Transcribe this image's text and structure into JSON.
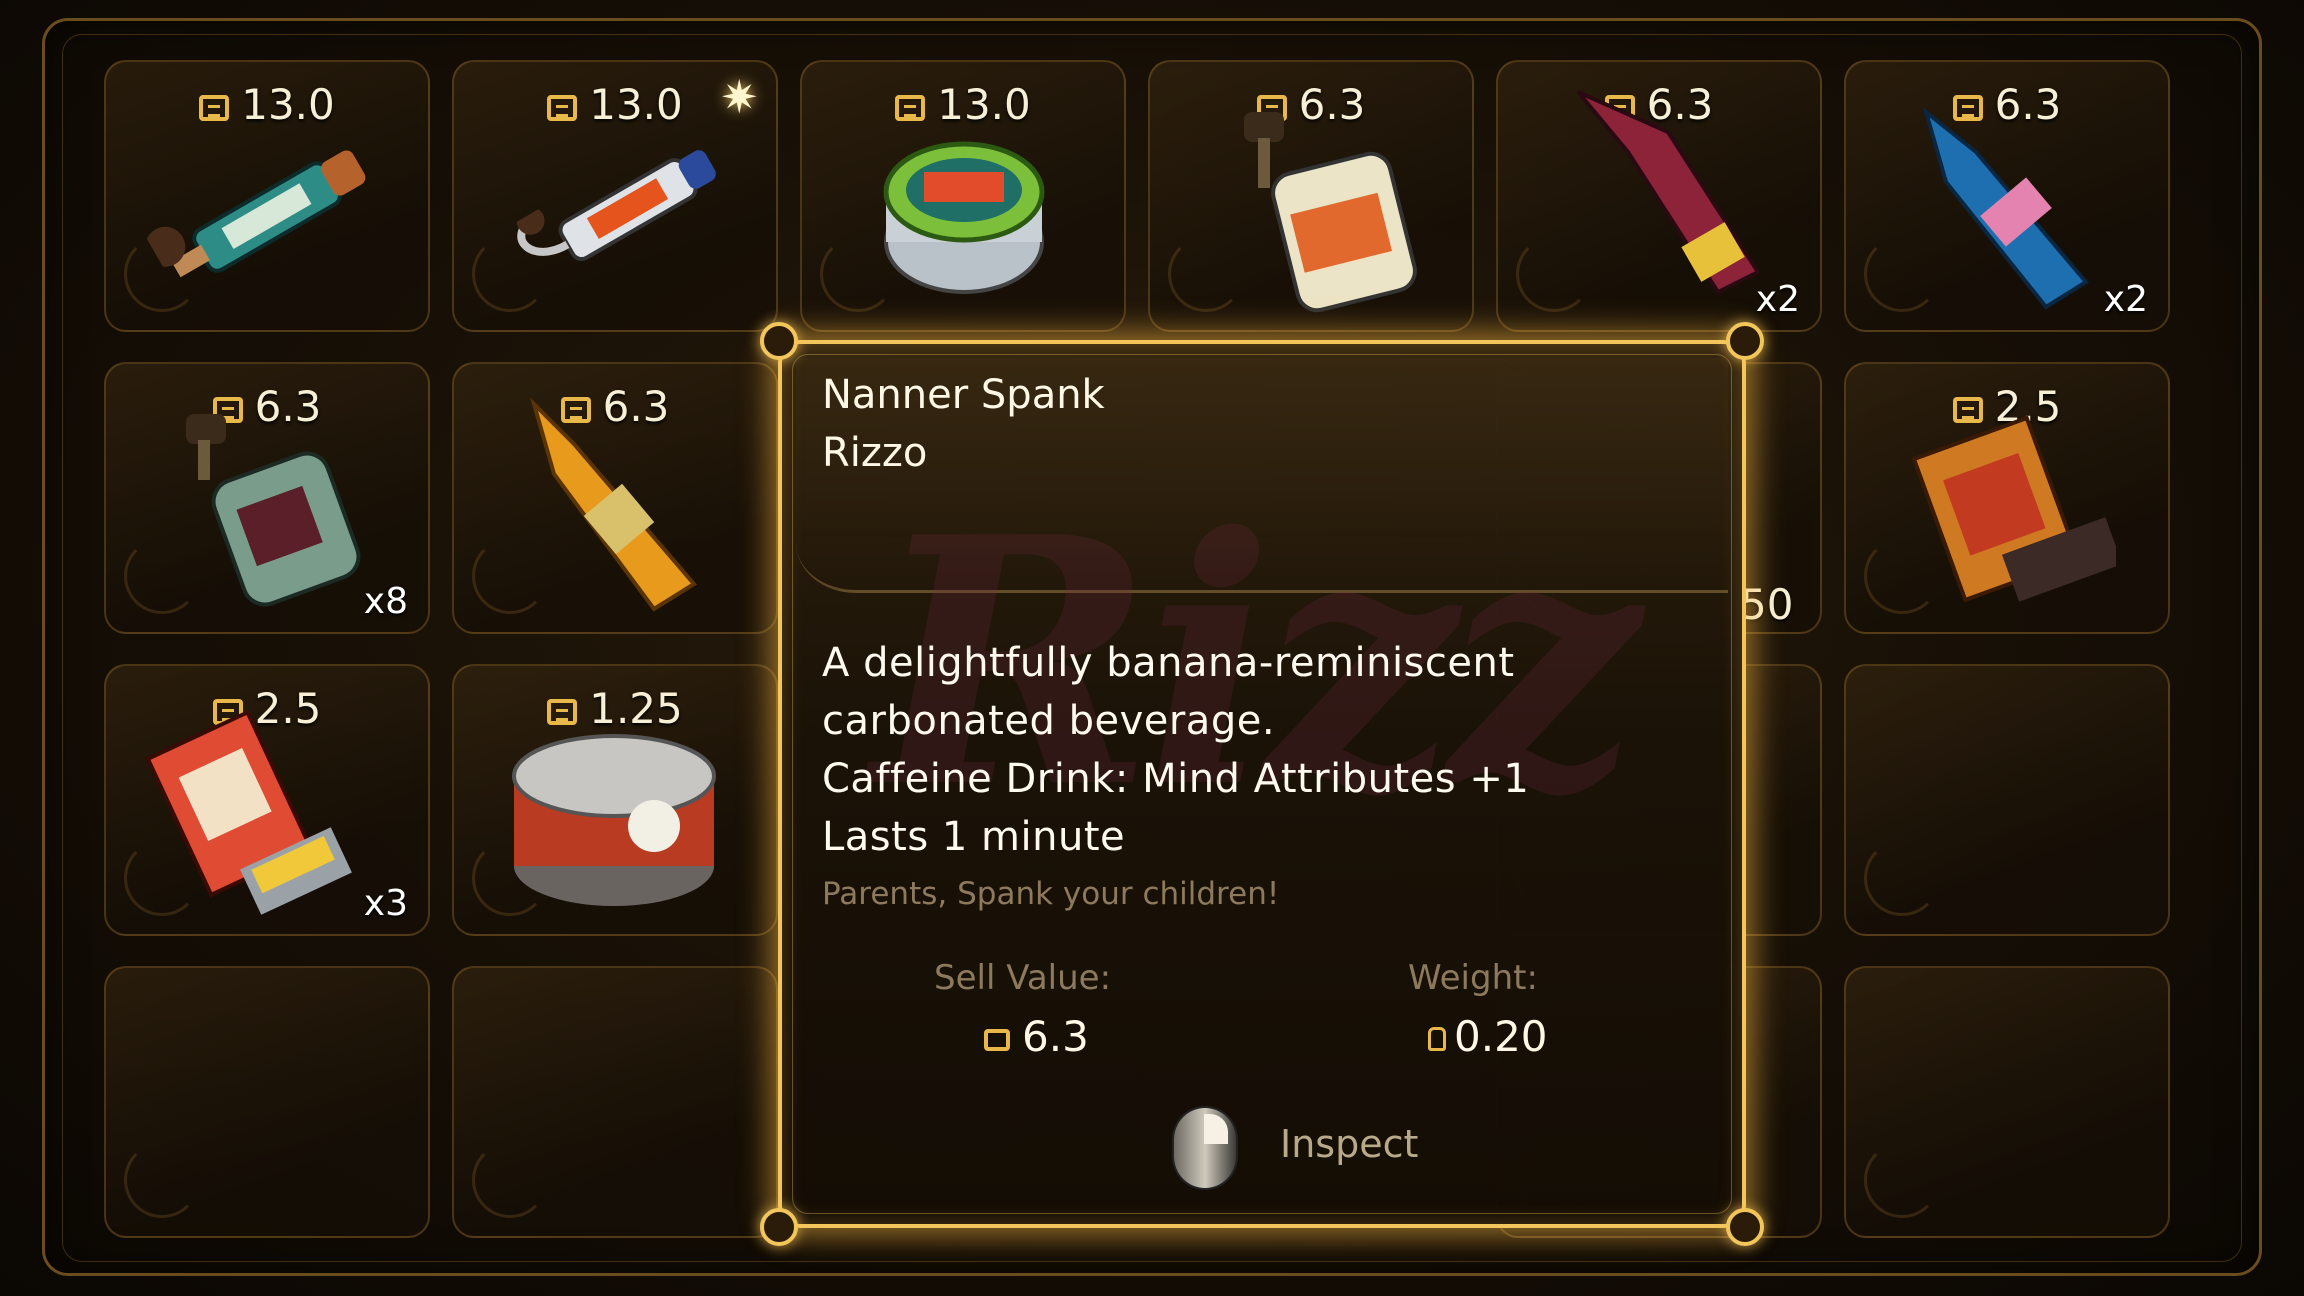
{
  "inventory": {
    "slots": [
      {
        "price": "13.0",
        "qty": "",
        "item_icon": "lubricating-tube-icon"
      },
      {
        "price": "13.0",
        "qty": "",
        "item_icon": "hook-tube-icon"
      },
      {
        "price": "13.0",
        "qty": "",
        "item_icon": "metallisys-gel-jar-icon"
      },
      {
        "price": "6.3",
        "qty": "",
        "item_icon": "elixir-bottle-icon"
      },
      {
        "price": "6.3",
        "qty": "x2",
        "item_icon": "red-bottle-icon"
      },
      {
        "price": "6.3",
        "qty": "x2",
        "item_icon": "blue-bottle-icon"
      },
      {
        "price": "6.3",
        "qty": "x8",
        "item_icon": "green-bottle-icon"
      },
      {
        "price": "6.3",
        "qty": "",
        "item_icon": "rizzo-bottle-icon"
      },
      {
        "price": "2.5",
        "qty": "",
        "item_icon": "red-box-icon"
      },
      {
        "price": "2.5",
        "qty": "x3",
        "item_icon": "matchbox-icon"
      },
      {
        "price": "1.25",
        "qty": "",
        "item_icon": "tin-can-icon"
      }
    ],
    "hidden_partial": "50"
  },
  "tooltip": {
    "name": "Nanner Spank",
    "brand": "Rizzo",
    "watermark": "Rizz",
    "description": [
      "A delightfully banana-reminiscent",
      "carbonated beverage.",
      "Caffeine Drink: Mind Attributes +1",
      "Lasts 1 minute"
    ],
    "flavor": "Parents, Spank your children!",
    "sell_label": "Sell Value:",
    "sell_value": "6.3",
    "weight_label": "Weight:",
    "weight_value": "0.20",
    "inspect_label": "Inspect"
  },
  "colors": {
    "accent": "#f3c65c",
    "background": "#160f06",
    "muted_text": "#8d7a5c"
  }
}
